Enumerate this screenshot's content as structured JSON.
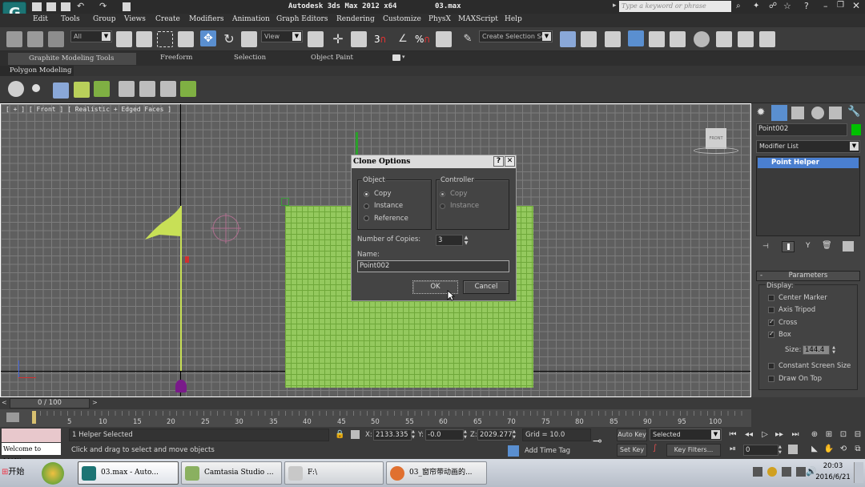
{
  "titlebar": {
    "app_title": "Autodesk 3ds Max  2012 x64",
    "file_name": "03.max",
    "search_placeholder": "Type a keyword or phrase"
  },
  "menu": [
    "Edit",
    "Tools",
    "Group",
    "Views",
    "Create",
    "Modifiers",
    "Animation",
    "Graph Editors",
    "Rendering",
    "Customize",
    "PhysX",
    "MAXScript",
    "Help"
  ],
  "toolbar": {
    "selection_filter": "All",
    "reference_coord": "View",
    "snap_label": "3",
    "percent_snap_label": "%",
    "create_selection_set_placeholder": "Create Selection Se"
  },
  "ribbon": {
    "tabs": [
      "Graphite Modeling Tools",
      "Freeform",
      "Selection",
      "Object Paint"
    ],
    "subtab": "Polygon Modeling"
  },
  "viewport": {
    "label": "[ + ] [ Front ] [ Realistic + Edged Faces ]",
    "viewcube_label": "FRONT"
  },
  "dialog": {
    "title": "Clone Options",
    "help_btn": "?",
    "close_btn": "✕",
    "object_group": "Object",
    "object_options": [
      "Copy",
      "Instance",
      "Reference"
    ],
    "object_selected": "Copy",
    "controller_group": "Controller",
    "controller_options": [
      "Copy",
      "Instance"
    ],
    "controller_selected": "Copy",
    "copies_label": "Number of Copies:",
    "copies_value": "3",
    "name_label": "Name:",
    "name_value": "Point002",
    "ok": "OK",
    "cancel": "Cancel"
  },
  "cmdpanel": {
    "object_name": "Point002",
    "object_color": "#00c000",
    "modifier_list": "Modifier List",
    "stack_item": "Point Helper",
    "rollout_title": "Parameters",
    "display_label": "Display:",
    "options": [
      {
        "label": "Center Marker",
        "checked": false
      },
      {
        "label": "Axis Tripod",
        "checked": false
      },
      {
        "label": "Cross",
        "checked": true
      },
      {
        "label": "Box",
        "checked": true
      }
    ],
    "size_label": "Size:",
    "size_value": "144.4",
    "options2": [
      {
        "label": "Constant Screen Size",
        "checked": false
      },
      {
        "label": "Draw On Top",
        "checked": false
      }
    ]
  },
  "timeline": {
    "frame": "0 / 100",
    "prev": "<",
    "next": ">",
    "ticks": [
      "5",
      "10",
      "15",
      "20",
      "25",
      "30",
      "35",
      "40",
      "45",
      "50",
      "55",
      "60",
      "65",
      "70",
      "75",
      "80",
      "85",
      "90",
      "95",
      "100"
    ]
  },
  "status": {
    "maxscript_listener": "Welcome to MAX!",
    "selection": "1 Helper Selected",
    "prompt": "Click and drag to select and move objects",
    "x_label": "X:",
    "x_value": "2133.335",
    "y_label": "Y:",
    "y_value": "-0.0",
    "z_label": "Z:",
    "z_value": "2029.277",
    "grid": "Grid = 10.0",
    "add_time_tag": "Add Time Tag",
    "auto_key": "Auto Key",
    "set_key": "Set Key",
    "key_mode": "Selected",
    "key_filters": "Key Filters...",
    "current_frame": "0"
  },
  "taskbar": {
    "start": "开始",
    "tasks": [
      "03.max - Auto...",
      "Camtasia Studio ...",
      "F:\\",
      "03_窗帘带动画的..."
    ],
    "time": "20:03",
    "date": "2016/6/21"
  }
}
